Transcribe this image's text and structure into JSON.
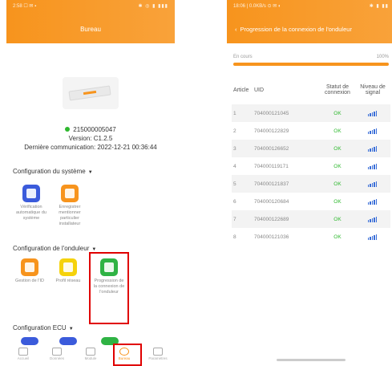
{
  "left": {
    "status": {
      "time": "2:58 ☐ ✉ ▪",
      "icons": "✱ ◎ ▮ ▮▮▮"
    },
    "header_title": "Bureau",
    "device": {
      "serial": "215000005047",
      "version": "Version: C1.2.5",
      "last_comm": "Dernière communication: 2022-12-21 00:36:44"
    },
    "sections": {
      "system": "Configuration du système",
      "inverter": "Configuration de l'onduleur",
      "ecu": "Configuration ECU"
    },
    "system_tiles": [
      {
        "label": "Vérification automatique du système",
        "color": "#3b5bdb",
        "icon": "clipboard-icon"
      },
      {
        "label": "Enregistrer mentionner particulier installateur",
        "color": "#f7941d",
        "icon": "person-icon"
      }
    ],
    "inverter_tiles": [
      {
        "label": "Gestion de l'ID",
        "color": "#f7941d",
        "icon": "id-card-icon"
      },
      {
        "label": "Profil réseau",
        "color": "#f5d20c",
        "icon": "list-icon"
      },
      {
        "label": "Progression de la connexion de l'onduleur",
        "color": "#2fb344",
        "icon": "link-icon"
      }
    ],
    "ecu_tiles": [
      {
        "color": "#3b5bdb"
      },
      {
        "color": "#3b5bdb"
      },
      {
        "color": "#2fb344"
      }
    ],
    "tabs": [
      "Accueil",
      "Données",
      "Module",
      "Bureau",
      "Paramètres"
    ],
    "active_tab": 3
  },
  "right": {
    "status": {
      "time": "18:06 | 0.0KB/s ⊙ ✉ ◐",
      "icons": "✱ ▮ ▮▮"
    },
    "header_title": "Progression de la connexion de l'onduleur",
    "progress_label": "En cours",
    "progress_pct_text": "100%",
    "progress_fraction": 1.0,
    "columns": [
      "Article",
      "UID",
      "Statut de connexion",
      "Niveau de signal"
    ],
    "rows": [
      {
        "article": "1",
        "uid": "704000121045",
        "status": "OK",
        "signal": "signal-icon"
      },
      {
        "article": "2",
        "uid": "704000122829",
        "status": "OK",
        "signal": "signal-icon"
      },
      {
        "article": "3",
        "uid": "704000126652",
        "status": "OK",
        "signal": "signal-icon"
      },
      {
        "article": "4",
        "uid": "704000119171",
        "status": "OK",
        "signal": "signal-icon"
      },
      {
        "article": "5",
        "uid": "704000121837",
        "status": "OK",
        "signal": "signal-icon"
      },
      {
        "article": "6",
        "uid": "704000120684",
        "status": "OK",
        "signal": "signal-icon"
      },
      {
        "article": "7",
        "uid": "704000122689",
        "status": "OK",
        "signal": "signal-icon"
      },
      {
        "article": "8",
        "uid": "704000121036",
        "status": "OK",
        "signal": "signal-icon"
      }
    ]
  },
  "colors": {
    "accent": "#f7941d",
    "ok": "#2eb82e",
    "highlight": "#e00000",
    "signal": "#3b6fd8"
  }
}
